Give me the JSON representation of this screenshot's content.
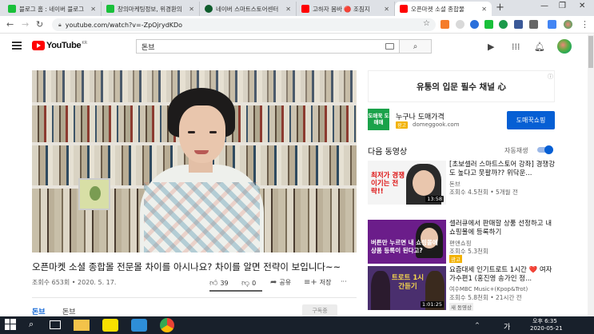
{
  "tabs": [
    {
      "title": "블로그 홈 : 네이버 블로그",
      "color": "#19c03a"
    },
    {
      "title": "창의마케팅정보, 위경환의",
      "color": "#19c03a"
    },
    {
      "title": "네이버 스마트스토어센터",
      "color": "#0e5c2c"
    },
    {
      "title": "고하자 몸바 🔴 조짐지",
      "color": "#ff0000"
    },
    {
      "title": "오픈마켓 소셜 종합물",
      "color": "#ff0000"
    }
  ],
  "address": {
    "url": "youtube.com/watch?v=-ZpOjrydKDo"
  },
  "youtube": {
    "logo_text": "YouTube",
    "logo_region": "KR",
    "search_value": "돈브"
  },
  "video": {
    "title": "오픈마켓 소셜 종합몰 전문몰 차이를 아시나요? 차이를 알면 전략이 보입니다~~",
    "meta": "조회수 653회 • 2020. 5. 17.",
    "likes": "39",
    "dislikes": "0",
    "like_ratio": 1.0,
    "share_label": "공유",
    "save_label": "저장",
    "more_label": "···",
    "channel_short": "돈브",
    "channel_name": "돈브",
    "subscribe_label": "구독중"
  },
  "ad": {
    "banner_text": "유통의 입문 필수 채널 心",
    "info_icon": "ⓘ",
    "logo_text": "도매꾹 도매매",
    "title": "누구나 도매가격",
    "badge": "광고",
    "domain": "domeggook.com",
    "button_label": "도매꾹쇼핑"
  },
  "next": {
    "header": "다음 동영상",
    "autoplay_label": "자동재생",
    "autoplay_on": true
  },
  "recommendations": [
    {
      "title": "[초보셀러 스마트스토어 강좌] 경쟁강도 높다고 못팔까?? 위닥운...",
      "channel": "돈브",
      "meta": "조회수 4.5천회 • 5개월 전",
      "duration": "13:58",
      "thumb_text": "최저가 경쟁 이기는 전략!!"
    },
    {
      "title": "셀러큐에서 판매할 상품 선정하고 내 쇼핑몰에 등록하기",
      "channel": "편앤쇼핑",
      "meta": "조회수 5.3천회",
      "badge": "광고",
      "thumb_text": "버튼만 누르면 내 쇼핑몰에 상품 등록이 된다고?"
    },
    {
      "title": "요즘대세 인기트로트 1시간 ❤️ 여자가수편1 (홍진영 송가인 정...",
      "channel": "여수MBC Music+(Kpop&Trot)",
      "meta": "조회수 5.8천회 • 21시간 전",
      "badge": "새 동영상",
      "duration": "1:01:25",
      "thumb_text": "트로트 1시간듣기"
    }
  ],
  "taskbar": {
    "time": "오후 6:35",
    "date": "2020-05-21",
    "lang": "가"
  }
}
